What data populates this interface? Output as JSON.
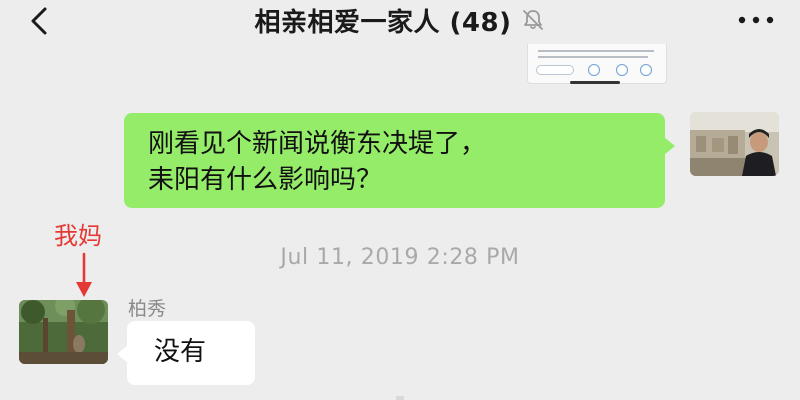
{
  "header": {
    "title": "相亲相爱一家人 (48)",
    "back_icon": "chevron-left-icon",
    "mute_icon": "bell-slash-icon",
    "more_icon": "more-dots-icon"
  },
  "messages": [
    {
      "side": "right",
      "avatar_icon": "user-avatar-photo",
      "text_line1": "刚看见个新闻说衡东决堤了，",
      "text_line2": "耒阳有什么影响吗？"
    },
    {
      "side": "left",
      "sender": "柏秀",
      "avatar_icon": "user-avatar-photo",
      "text": "没有"
    }
  ],
  "timestamp": "Jul 11, 2019 2:28 PM",
  "annotation": {
    "label": "我妈",
    "color": "#e53935",
    "arrow_icon": "arrow-down-icon"
  },
  "colors": {
    "background": "#ededed",
    "self_bubble": "#95ec69",
    "other_bubble": "#ffffff"
  }
}
